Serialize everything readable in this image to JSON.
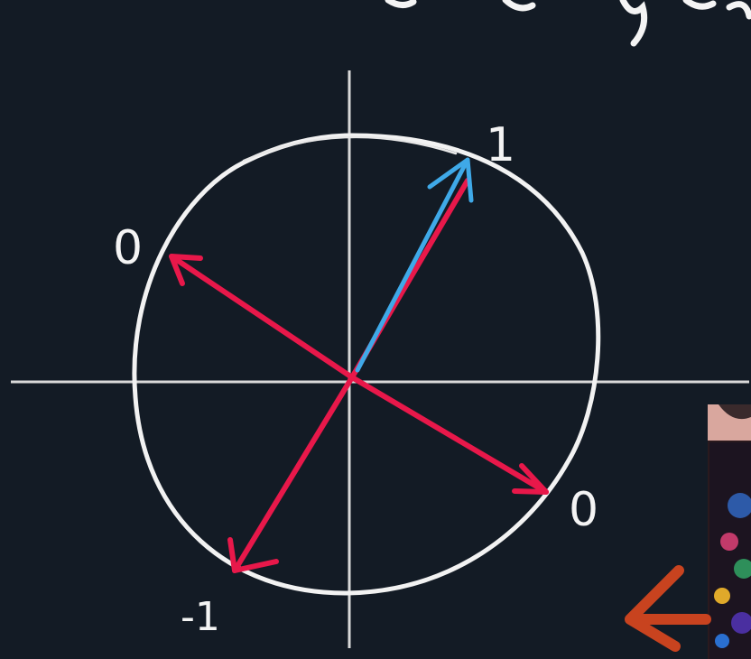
{
  "diagram": {
    "labels": {
      "top_right": "1",
      "upper_left": "0",
      "lower_right": "0",
      "bottom_left": "-1"
    },
    "colors": {
      "background": "#131b25",
      "axes": "#d9d9d9",
      "circle": "#f2f2f2",
      "red_vector": "#e8184a",
      "blue_vector": "#3fa9e8",
      "label": "#f4f4f4",
      "pointer_arrow": "#c8431f"
    }
  }
}
